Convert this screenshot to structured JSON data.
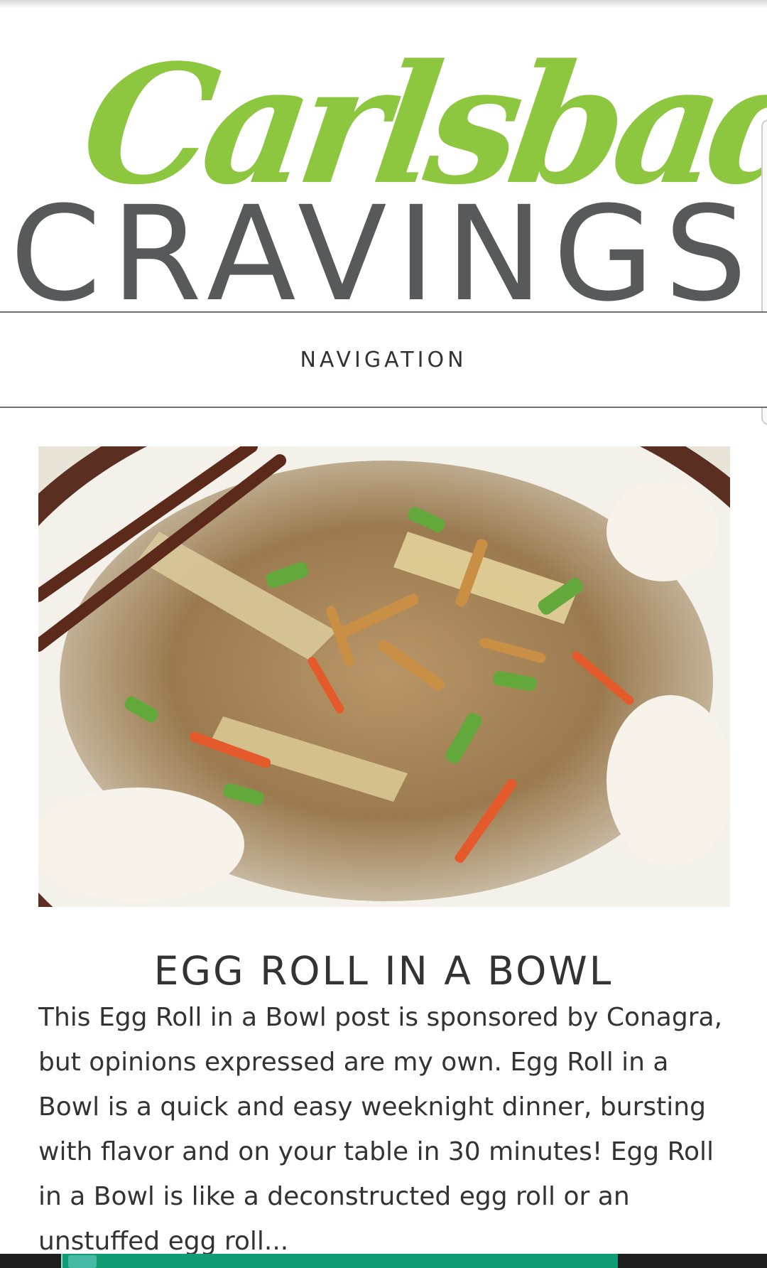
{
  "logo": {
    "script_text": "Carlsbad",
    "word_text": "CRAVINGS"
  },
  "nav": {
    "label": "NAVIGATION"
  },
  "hero": {
    "alt": "Egg Roll in a Bowl"
  },
  "post": {
    "title": "EGG ROLL IN A BOWL",
    "excerpt": "This Egg Roll in a Bowl post is sponsored by Conagra, but opinions expressed are my own. Egg Roll in a Bowl is a quick and easy weeknight dinner, bursting with flavor and on your table in 30 minutes! Egg Roll in a Bowl is like a deconstructed egg roll or an unstuffed egg roll..."
  },
  "colors": {
    "brand_green": "#8dc63f",
    "brand_gray": "#58595b",
    "ad_green": "#0f9b74"
  }
}
